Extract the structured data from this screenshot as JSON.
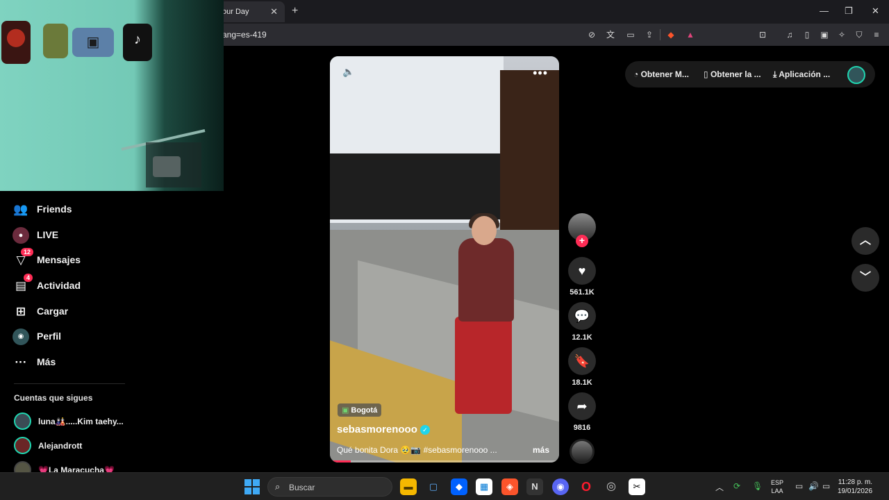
{
  "browser": {
    "tab_title": "our Day",
    "tab_close": "✕",
    "new_tab": "+",
    "url": "ang=es-419",
    "window_controls": [
      "—",
      "❐",
      "✕"
    ]
  },
  "sidebar": {
    "items": [
      {
        "label": "Friends",
        "icon": "friends-icon",
        "badge": ""
      },
      {
        "label": "LIVE",
        "icon": "live-icon",
        "badge": ""
      },
      {
        "label": "Mensajes",
        "icon": "messages-icon",
        "badge": "12"
      },
      {
        "label": "Actividad",
        "icon": "activity-icon",
        "badge": "4"
      },
      {
        "label": "Cargar",
        "icon": "upload-icon",
        "badge": ""
      },
      {
        "label": "Perfil",
        "icon": "profile-icon",
        "badge": ""
      },
      {
        "label": "Más",
        "icon": "more-icon",
        "badge": ""
      }
    ],
    "following_title": "Cuentas que sigues",
    "following": [
      {
        "name": "luna🎎.....Kim taehy..."
      },
      {
        "name": "Alejandrott"
      },
      {
        "name": "💗La Maracucha💗"
      }
    ]
  },
  "video": {
    "location": "Bogotá",
    "author": "sebasmorenooo",
    "caption": "Qué bonita Dora 🥹📷 #sebasmorenooo ...",
    "more": "más",
    "progress": 0.09
  },
  "actions": {
    "likes": "561.1K",
    "comments": "12.1K",
    "saves": "18.1K",
    "shares": "9816"
  },
  "top_pills": {
    "get_coins": "Obtener M...",
    "get_app": "Obtener la ...",
    "app": "Aplicación ..."
  },
  "taskbar": {
    "search_placeholder": "Buscar",
    "lang_line1": "ESP",
    "lang_line2": "LAA",
    "time": "11:28 p. m.",
    "date": "19/01/2026"
  }
}
